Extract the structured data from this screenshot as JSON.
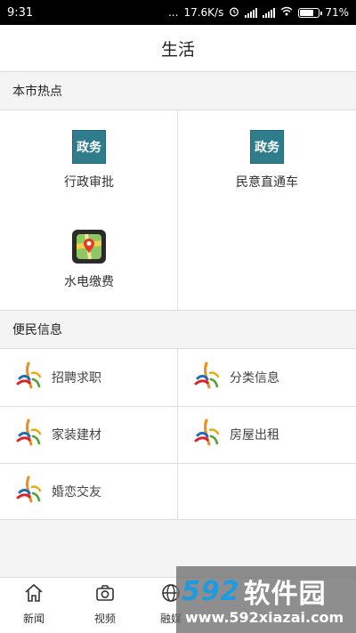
{
  "status_bar": {
    "time": "9:31",
    "dots": "...",
    "net_speed": "17.6K/s",
    "battery": "71%",
    "battery_level": 0.71
  },
  "header": {
    "title": "生活"
  },
  "hot_section": {
    "title": "本市热点",
    "items": [
      {
        "label": "行政审批",
        "icon": "gov-affairs-icon",
        "icon_text": "政务"
      },
      {
        "label": "民意直通车",
        "icon": "gov-affairs-icon",
        "icon_text": "政务"
      },
      {
        "label": "水电缴费",
        "icon": "map-pin-icon"
      }
    ]
  },
  "info_section": {
    "title": "便民信息",
    "items": [
      {
        "label": "招聘求职",
        "icon": "city-logo-icon"
      },
      {
        "label": "分类信息",
        "icon": "city-logo-icon"
      },
      {
        "label": "家装建材",
        "icon": "city-logo-icon"
      },
      {
        "label": "房屋出租",
        "icon": "city-logo-icon"
      },
      {
        "label": "婚恋交友",
        "icon": "city-logo-icon"
      }
    ]
  },
  "bottom_nav": {
    "items": [
      {
        "label": "新闻",
        "icon": "home-icon"
      },
      {
        "label": "视频",
        "icon": "camera-icon"
      },
      {
        "label": "融媒",
        "icon": "globe-icon"
      }
    ]
  },
  "watermark": {
    "logo_number": "592",
    "logo_text": "软件园",
    "url": "www.592xiazai.com"
  },
  "colors": {
    "gov_icon_bg": "#2e7c8c",
    "section_bg": "#f4f4f4",
    "divider": "#dcdcdc",
    "watermark_blue": "#1e9be0"
  }
}
